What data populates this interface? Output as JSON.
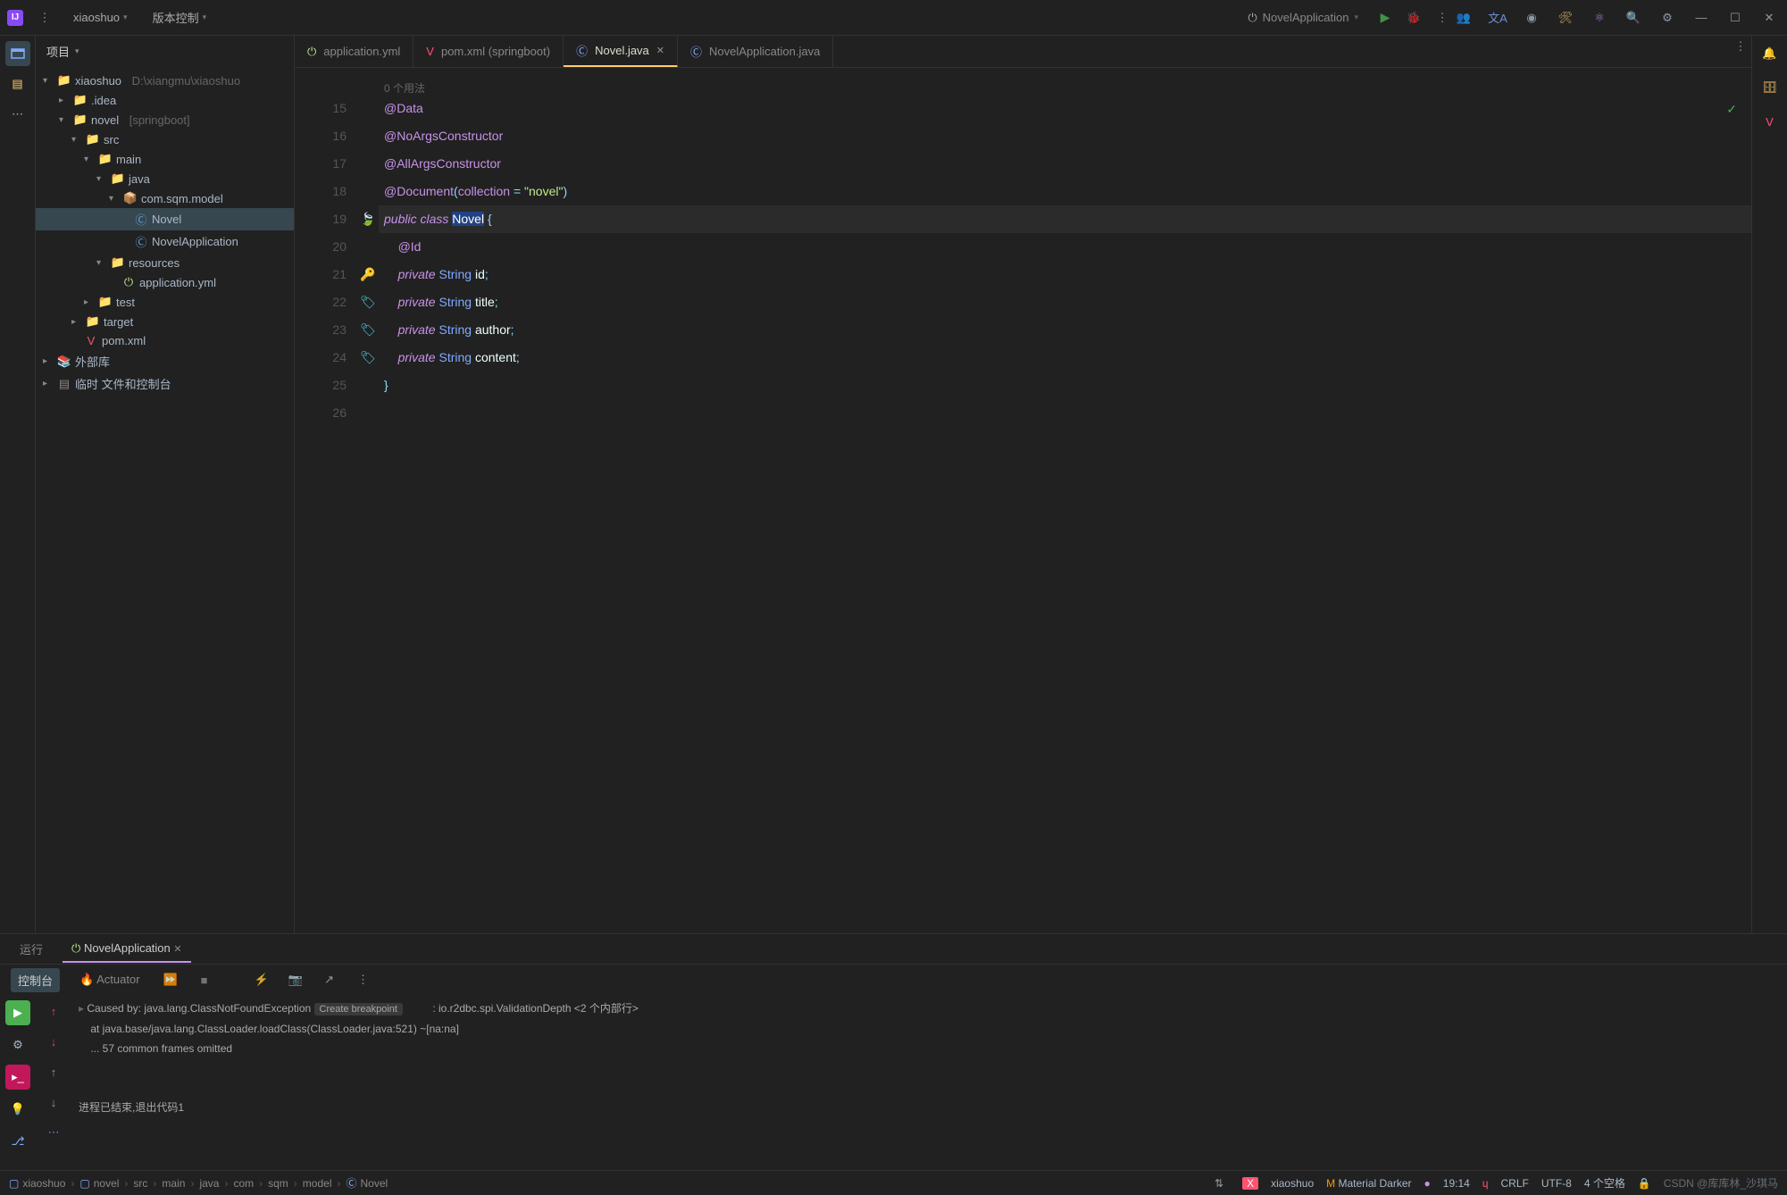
{
  "titlebar": {
    "project": "xiaoshuo",
    "vcs": "版本控制",
    "runConfig": "NovelApplication"
  },
  "sidebar": {
    "title": "项目",
    "root": {
      "name": "xiaoshuo",
      "path": "D:\\xiangmu\\xiaoshuo"
    },
    "tree": {
      "idea": ".idea",
      "novel": "novel",
      "novel_suffix": "[springboot]",
      "src": "src",
      "main": "main",
      "java": "java",
      "package": "com.sqm.model",
      "novel_class": "Novel",
      "novel_app": "NovelApplication",
      "resources": "resources",
      "app_yml": "application.yml",
      "test": "test",
      "target": "target",
      "pom": "pom.xml",
      "external": "外部库",
      "scratches": "临时 文件和控制台"
    }
  },
  "tabs": [
    {
      "icon": "power",
      "label": "application.yml"
    },
    {
      "icon": "maven",
      "label": "pom.xml (springboot)"
    },
    {
      "icon": "java",
      "label": "Novel.java",
      "active": true
    },
    {
      "icon": "java",
      "label": "NovelApplication.java"
    }
  ],
  "editor": {
    "usage": "0 个用法",
    "lines": {
      "15": "@Data",
      "16": "@NoArgsConstructor",
      "17": "@AllArgsConstructor",
      "18_doc": "@Document",
      "18_attr": "collection",
      "18_val": "\"novel\"",
      "19_public": "public",
      "19_class": "class",
      "19_name": "Novel",
      "20": "@Id",
      "21_mod": "private",
      "21_type": "String",
      "21_name": "id",
      "22_mod": "private",
      "22_type": "String",
      "22_name": "title",
      "23_mod": "private",
      "23_type": "String",
      "23_name": "author",
      "24_mod": "private",
      "24_type": "String",
      "24_name": "content"
    }
  },
  "run": {
    "label": "运行",
    "config": "NovelApplication",
    "console_tab": "控制台",
    "actuator_tab": "Actuator",
    "output": {
      "l1a": "Caused by: java.lang.ClassNotFoundException",
      "l1b": "Create breakpoint",
      "l1c": ": io.r2dbc.spi.ValidationDepth <2 个内部行>",
      "l2": "    at java.base/java.lang.ClassLoader.loadClass(ClassLoader.java:521) ~[na:na]",
      "l3": "    ... 57 common frames omitted",
      "l_exit": "进程已结束,退出代码1"
    }
  },
  "breadcrumb": {
    "items": [
      "xiaoshuo",
      "novel",
      "src",
      "main",
      "java",
      "com",
      "sqm",
      "model",
      "Novel"
    ]
  },
  "statusbar": {
    "project": "xiaoshuo",
    "theme": "Material Darker",
    "time": "19:14",
    "encoding": "CRLF",
    "charset": "UTF-8",
    "indent": "4 个空格",
    "watermark": "CSDN @库库林_沙琪马"
  }
}
